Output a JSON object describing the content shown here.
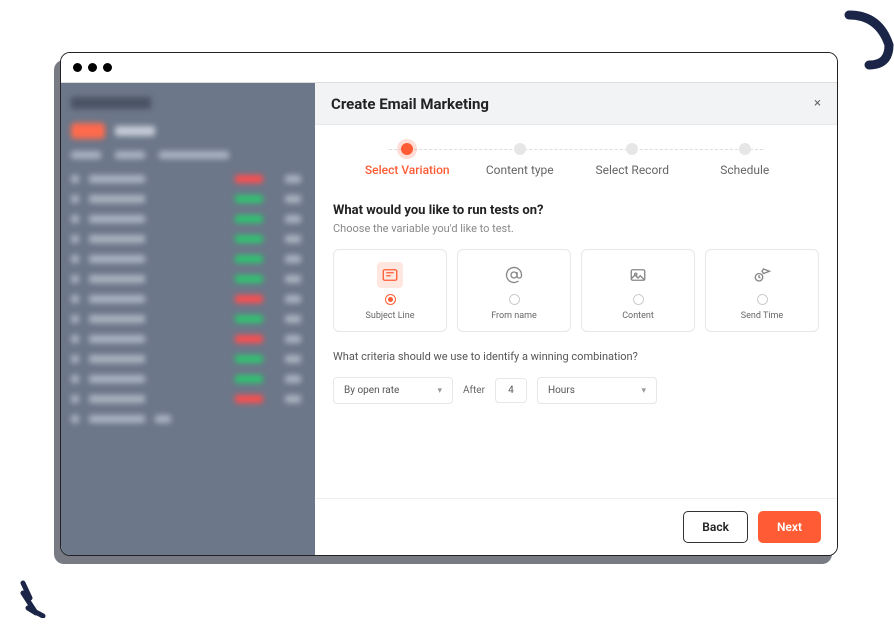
{
  "modal": {
    "title": "Create Email Marketing",
    "close_label": "×"
  },
  "stepper": {
    "steps": [
      {
        "label": "Select Variation",
        "active": true
      },
      {
        "label": "Content type",
        "active": false
      },
      {
        "label": "Select Record",
        "active": false
      },
      {
        "label": "Schedule",
        "active": false
      }
    ]
  },
  "variation": {
    "question": "What would you like to run tests on?",
    "subtext": "Choose the variable you'd like to test.",
    "options": [
      {
        "icon": "subject-line-icon",
        "label": "Subject Line",
        "selected": true
      },
      {
        "icon": "from-name-icon",
        "label": "From name",
        "selected": false
      },
      {
        "icon": "content-icon",
        "label": "Content",
        "selected": false
      },
      {
        "icon": "send-time-icon",
        "label": "Send Time",
        "selected": false
      }
    ]
  },
  "criteria": {
    "question": "What criteria should we use to identify a winning combination?",
    "metric": "By open rate",
    "after_label": "After",
    "after_value": "4",
    "unit": "Hours"
  },
  "footer": {
    "back": "Back",
    "next": "Next"
  },
  "colors": {
    "accent": "#ff5c35"
  }
}
